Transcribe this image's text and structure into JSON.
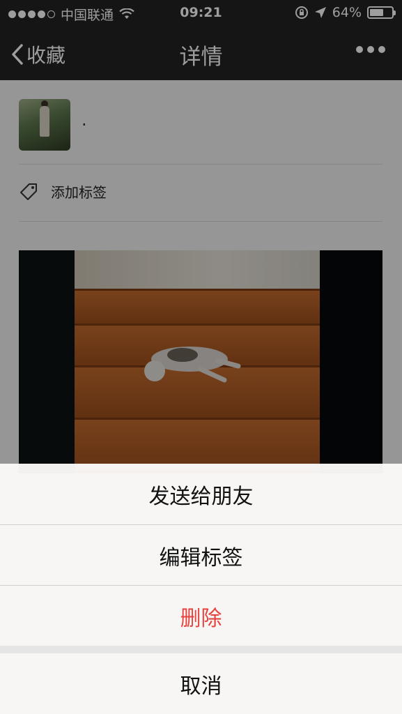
{
  "status_bar": {
    "carrier": "中国联通",
    "time": "09:21",
    "battery": "64%",
    "battery_level": 0.64
  },
  "nav": {
    "back_label": "收藏",
    "title": "详情"
  },
  "detail": {
    "name": "·",
    "tag_label": "添加标签"
  },
  "action_sheet": {
    "send": "发送给朋友",
    "edit_tags": "编辑标签",
    "delete": "删除",
    "cancel": "取消"
  },
  "colors": {
    "nav_bg": "#222222",
    "danger": "#e64340"
  }
}
